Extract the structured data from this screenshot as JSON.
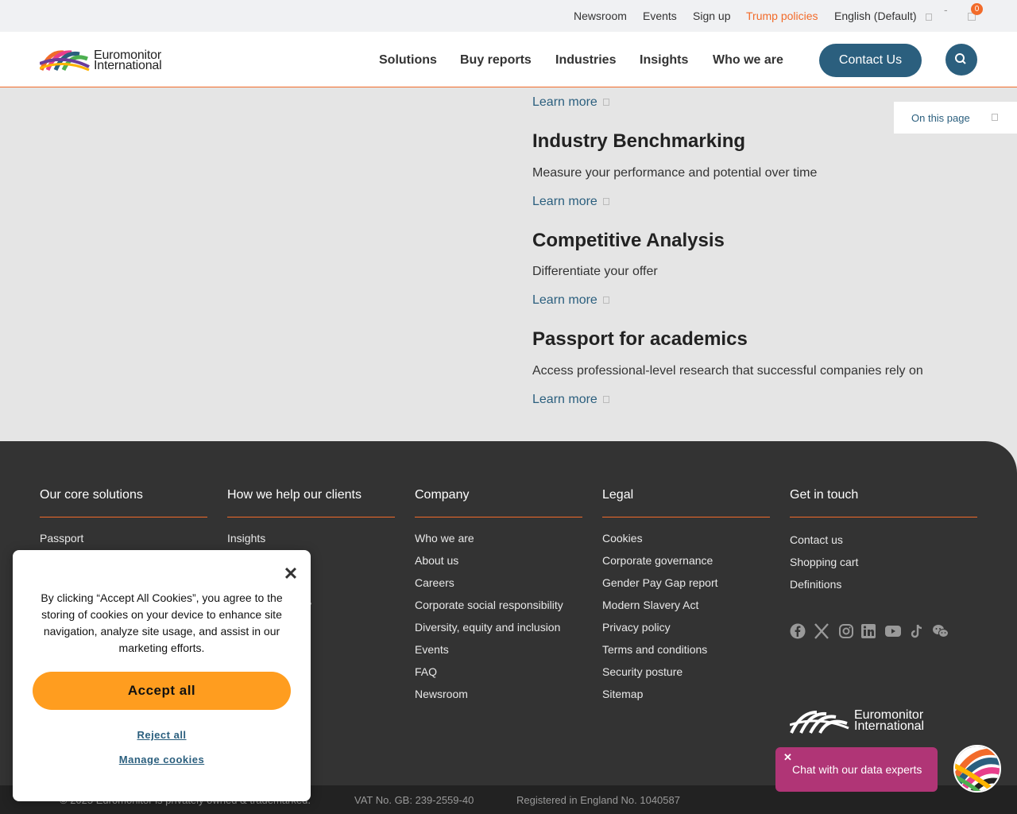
{
  "utility_nav": {
    "items": [
      "Newsroom",
      "Events",
      "Sign up",
      "Trump policies"
    ],
    "language": "English (Default)",
    "cart_count": "0"
  },
  "header": {
    "logo_line1": "Euromonitor",
    "logo_line2": "International",
    "nav": [
      "Solutions",
      "Buy reports",
      "Industries",
      "Insights",
      "Who we are"
    ],
    "contact_label": "Contact Us"
  },
  "on_this_page": {
    "label": "On this page"
  },
  "content": {
    "learn_more": "Learn more",
    "solutions": [
      {
        "title": "Industry Benchmarking",
        "description": "Measure your performance and potential over time"
      },
      {
        "title": "Competitive Analysis",
        "description": "Differentiate your offer"
      },
      {
        "title": "Passport for academics",
        "description": "Access professional-level research that successful companies rely on"
      }
    ]
  },
  "footer": {
    "columns": [
      {
        "heading": "Our core solutions",
        "links": [
          "Passport",
          "",
          "",
          "",
          "",
          "",
          "",
          ""
        ]
      },
      {
        "heading": "How we help our clients",
        "links": [
          "Insights",
          "",
          "",
          "ity",
          "",
          "",
          "",
          ""
        ]
      },
      {
        "heading": "Company",
        "links": [
          "Who we are",
          "About us",
          "Careers",
          "Corporate social responsibility",
          "Diversity, equity and inclusion",
          "Events",
          "FAQ",
          "Newsroom"
        ]
      },
      {
        "heading": "Legal",
        "links": [
          "Cookies",
          "Corporate governance",
          "Gender Pay Gap report",
          "Modern Slavery Act",
          "Privacy policy",
          "Terms and conditions",
          "Security posture",
          "Sitemap"
        ]
      },
      {
        "heading": "Get in touch",
        "links": [
          "Contact us",
          "Shopping cart",
          "Definitions"
        ]
      }
    ],
    "social_icons": [
      "facebook-icon",
      "x-icon",
      "instagram-icon",
      "linkedin-icon",
      "youtube-icon",
      "tiktok-icon",
      "wechat-icon"
    ],
    "logo_line1": "Euromonitor",
    "logo_line2": "International"
  },
  "bottom_bar": {
    "copyright": "© 2025 Euromonitor is privately owned & trademarked.",
    "vat": "VAT No. GB: 239-2559-40",
    "registered": "Registered in England No. 1040587"
  },
  "cookie_banner": {
    "text": "By clicking “Accept All Cookies”, you agree to the storing of cookies on your device to enhance site navigation, analyze site usage, and assist in our marketing efforts.",
    "accept_label": "Accept all",
    "reject_label": "Reject all",
    "manage_label": "Manage cookies"
  },
  "chat": {
    "label": "Chat with our data experts"
  },
  "colors": {
    "accent_orange": "#f26b2a",
    "brand_blue": "#2b5f7e",
    "accept_orange": "#ff9d1f",
    "chat_magenta": "#b03576",
    "footer_dark": "#333333"
  }
}
